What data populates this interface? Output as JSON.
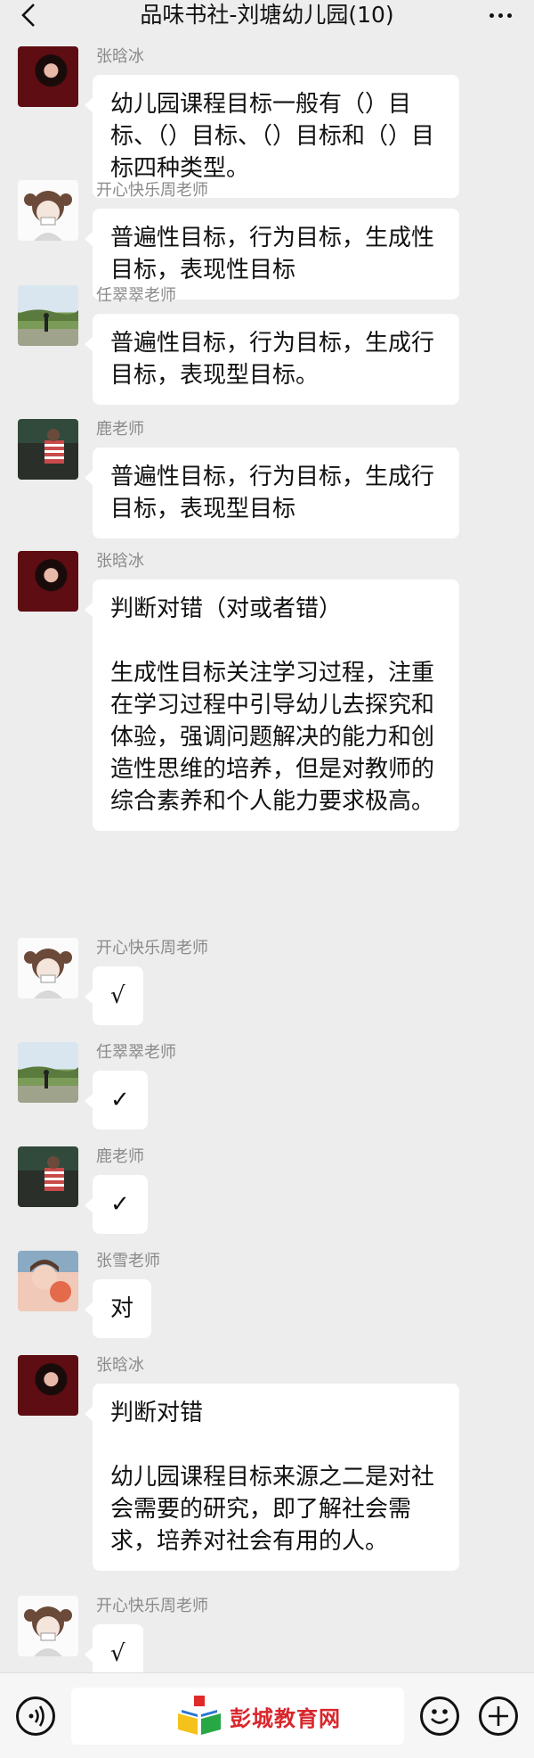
{
  "header": {
    "title": "品味书社-刘塘幼儿园(10)"
  },
  "messages": [
    {
      "sender": "张晗冰",
      "text": "幼儿园课程目标一般有（）目标、（）目标、（）目标和（）目标四种类型。"
    },
    {
      "sender": "开心快乐周老师",
      "text": "普遍性目标，行为目标，生成性目标，表现性目标"
    },
    {
      "sender": "任翠翠老师",
      "text": "普遍性目标，行为目标，生成行目标，表现型目标。"
    },
    {
      "sender": "鹿老师",
      "text": "普遍性目标，行为目标，生成行目标，表现型目标"
    },
    {
      "sender": "张晗冰",
      "text": "判断对错（对或者错）\n\n生成性目标关注学习过程，注重在学习过程中引导幼儿去探究和体验，强调问题解决的能力和创造性思维的培养，但是对教师的综合素养和个人能力要求极高。"
    },
    {
      "sender": "开心快乐周老师",
      "text": "√"
    },
    {
      "sender": "任翠翠老师",
      "text": "✓"
    },
    {
      "sender": "鹿老师",
      "text": "✓"
    },
    {
      "sender": "张雪老师",
      "text": "对"
    },
    {
      "sender": "张晗冰",
      "text": "判断对错\n\n幼儿园课程目标来源之二是对社会需要的研究，即了解社会需求，培养对社会有用的人。"
    },
    {
      "sender": "开心快乐周老师",
      "text": "√"
    }
  ],
  "watermark": {
    "text": "彭城教育网"
  },
  "icons": {
    "back": "chevron-left-icon",
    "more": "more-icon",
    "voice": "voice-icon",
    "emoji": "emoji-icon",
    "plus": "plus-icon"
  }
}
